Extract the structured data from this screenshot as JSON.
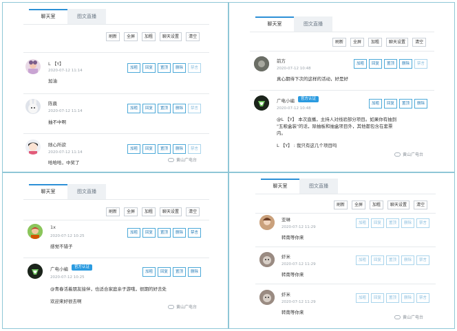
{
  "labels": {
    "tab_chat": "聊天室",
    "tab_live": "图文直播",
    "refresh": "刷新",
    "fullscreen": "全屏",
    "bold": "加粗",
    "chat_settings": "聊天设置",
    "clear": "清空",
    "action_bold": "加粗",
    "action_reply": "回复",
    "action_pin": "置顶",
    "action_delete": "删除",
    "action_ban": "禁言",
    "official_badge": "官方认证",
    "watermark": "黄山广电台"
  },
  "panel1": {
    "tab_active": "聊天室",
    "tab_other": "图文直播",
    "toolbar": [
      "刷新",
      "全屏",
      "加粗",
      "聊天设置",
      "清空"
    ],
    "messages": [
      {
        "name": "L 【Y】",
        "time": "2020-07-12 11:14",
        "text": "加油"
      },
      {
        "name": "陈晨",
        "time": "2020-07-12 11:14",
        "text": "抽不中啊"
      },
      {
        "name": "随心所欲",
        "time": "2020-07-12 11:14",
        "text": "哈哈哈，中奖了"
      }
    ],
    "actions": [
      "加粗",
      "回复",
      "置顶",
      "删除",
      "禁言"
    ],
    "watermark": "黄山广电台"
  },
  "panel2": {
    "tab_active": "聊天室",
    "tab_other": "图文直播",
    "toolbar": [
      "刷新",
      "全屏",
      "加粗",
      "聊天设置",
      "清空"
    ],
    "messages": [
      {
        "name": "前方",
        "time": "2020-07-12 10:48",
        "text": "真心期待下次的这样的活动，好是好",
        "actions": [
          "加粗",
          "回复",
          "置顶",
          "删除",
          "禁言"
        ]
      },
      {
        "name": "广电小编",
        "badge": "官方认证",
        "time": "2020-07-12 10:48",
        "text_lines": [
          "@L 【Y】 本次直播，主持人对线验部分项目。如果你有抽到",
          "\"五粮盒装\"的话，除抽板和抽盒项目外，其他都包含在套票",
          "内。"
        ],
        "extra": "L 【Y】 : 我只有这几个项目吗",
        "actions": [
          "加粗",
          "回复",
          "置顶",
          "删除"
        ]
      }
    ],
    "watermark": "黄山广电台"
  },
  "panel3": {
    "tab_active": "聊天室",
    "tab_other": "图文直播",
    "toolbar": [
      "刷新",
      "全屏",
      "加粗",
      "聊天设置",
      "清空"
    ],
    "messages": [
      {
        "name": "1x",
        "time": "2020-07-12 10:25",
        "text": "感觉不错子",
        "actions": [
          "加粗",
          "回复",
          "置顶",
          "删除",
          "禁言"
        ]
      },
      {
        "name": "广电小编",
        "badge": "官方认证",
        "time": "2020-07-12 10:25",
        "text": "@青春活着朋友接伴，也适合家庭亲子游哦，很期的好去处",
        "extra": "欢迎来好很去啊",
        "actions": [
          "加粗",
          "回复",
          "置顶",
          "删除"
        ]
      }
    ],
    "watermark": "黄山广电台"
  },
  "panel4": {
    "tab_active": "聊天室",
    "tab_other": "图文直播",
    "toolbar": [
      "刷新",
      "全屏",
      "加粗",
      "聊天设置",
      "清空"
    ],
    "messages": [
      {
        "name": "亚琳",
        "time": "2020-07-12 11:29",
        "text": "转南等你来"
      },
      {
        "name": "虾米",
        "time": "2020-07-12 11:29",
        "text": "转南等你来"
      },
      {
        "name": "虾米",
        "time": "2020-07-12 11:29",
        "text": "转南等你来"
      }
    ],
    "actions": [
      "加粗",
      "回复",
      "置顶",
      "删除",
      "禁言"
    ],
    "watermark": "黄山广电台"
  }
}
